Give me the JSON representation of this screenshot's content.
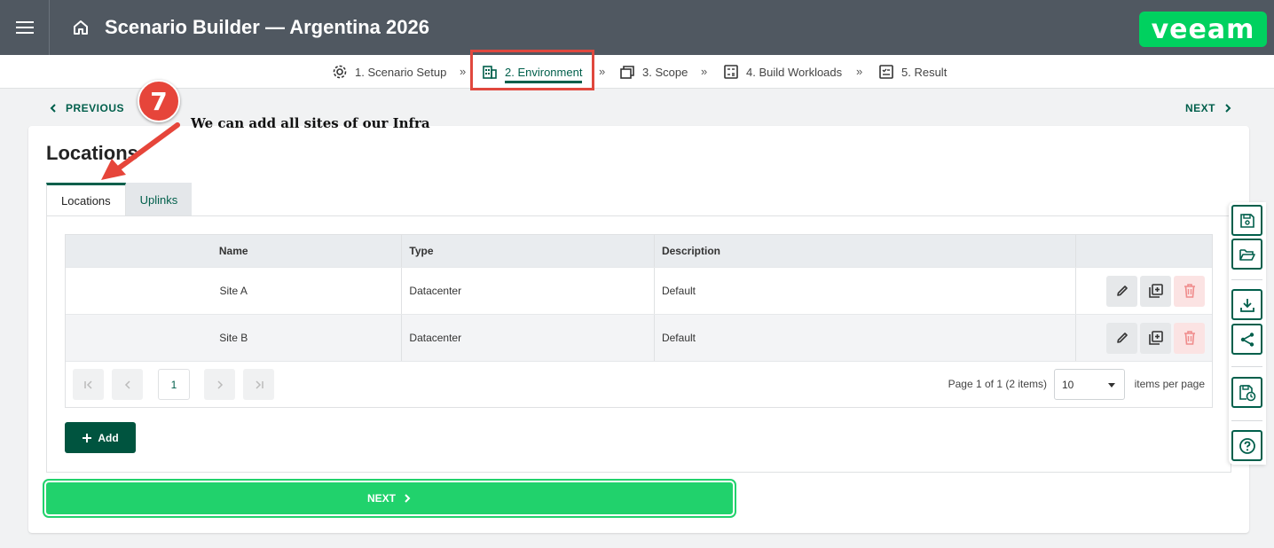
{
  "header": {
    "title": "Scenario Builder — Argentina 2026",
    "logo_text": "veeam",
    "logo_color": "#00d15f",
    "bar_color": "#505861"
  },
  "stepper": {
    "steps": [
      {
        "label": "1. Scenario Setup",
        "icon": "gear-icon"
      },
      {
        "label": "2. Environment",
        "icon": "building-icon",
        "active": true
      },
      {
        "label": "3. Scope",
        "icon": "windows-icon"
      },
      {
        "label": "4. Build Workloads",
        "icon": "calculator-icon"
      },
      {
        "label": "5. Result",
        "icon": "checklist-icon"
      }
    ],
    "separator": "»"
  },
  "nav": {
    "previous_label": "PREVIOUS",
    "next_label": "NEXT"
  },
  "annotation": {
    "number": "7",
    "text": "We can add all sites of our Infra",
    "color": "#e6453a"
  },
  "main": {
    "title": "Locations",
    "tabs": [
      {
        "label": "Locations",
        "active": true
      },
      {
        "label": "Uplinks",
        "active": false
      }
    ],
    "table": {
      "columns": [
        "Name",
        "Type",
        "Description",
        ""
      ],
      "rows": [
        {
          "name": "Site A",
          "type": "Datacenter",
          "description": "Default"
        },
        {
          "name": "Site B",
          "type": "Datacenter",
          "description": "Default"
        }
      ]
    },
    "pager": {
      "current_page": "1",
      "info": "Page 1 of 1 (2 items)",
      "page_size": "10",
      "per_page_label": "items per page"
    },
    "add_label": "Add",
    "big_next_label": "NEXT"
  },
  "side_tools": [
    "save-icon",
    "open-folder-icon",
    "download-icon",
    "share-icon",
    "schedule-save-icon",
    "help-icon"
  ],
  "accent_color": "#005f4b"
}
